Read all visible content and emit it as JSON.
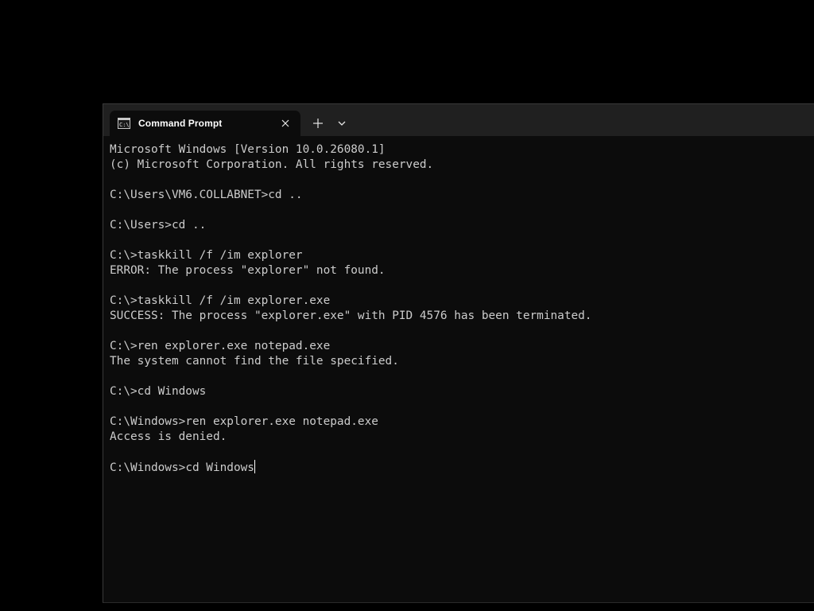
{
  "window": {
    "tab": {
      "icon": "cmd-icon",
      "title": "Command Prompt"
    },
    "new_tab_symbol": "+",
    "accent_colors": {
      "titlebar": "#202020",
      "console_bg": "#0c0c0c",
      "text": "#cccccc"
    }
  },
  "console": {
    "lines": [
      "Microsoft Windows [Version 10.0.26080.1]",
      "(c) Microsoft Corporation. All rights reserved.",
      "",
      "C:\\Users\\VM6.COLLABNET>cd ..",
      "",
      "C:\\Users>cd ..",
      "",
      "C:\\>taskkill /f /im explorer",
      "ERROR: The process \"explorer\" not found.",
      "",
      "C:\\>taskkill /f /im explorer.exe",
      "SUCCESS: The process \"explorer.exe\" with PID 4576 has been terminated.",
      "",
      "C:\\>ren explorer.exe notepad.exe",
      "The system cannot find the file specified.",
      "",
      "C:\\>cd Windows",
      "",
      "C:\\Windows>ren explorer.exe notepad.exe",
      "Access is denied.",
      ""
    ],
    "prompt": "C:\\Windows>",
    "current_input": "cd Windows"
  }
}
